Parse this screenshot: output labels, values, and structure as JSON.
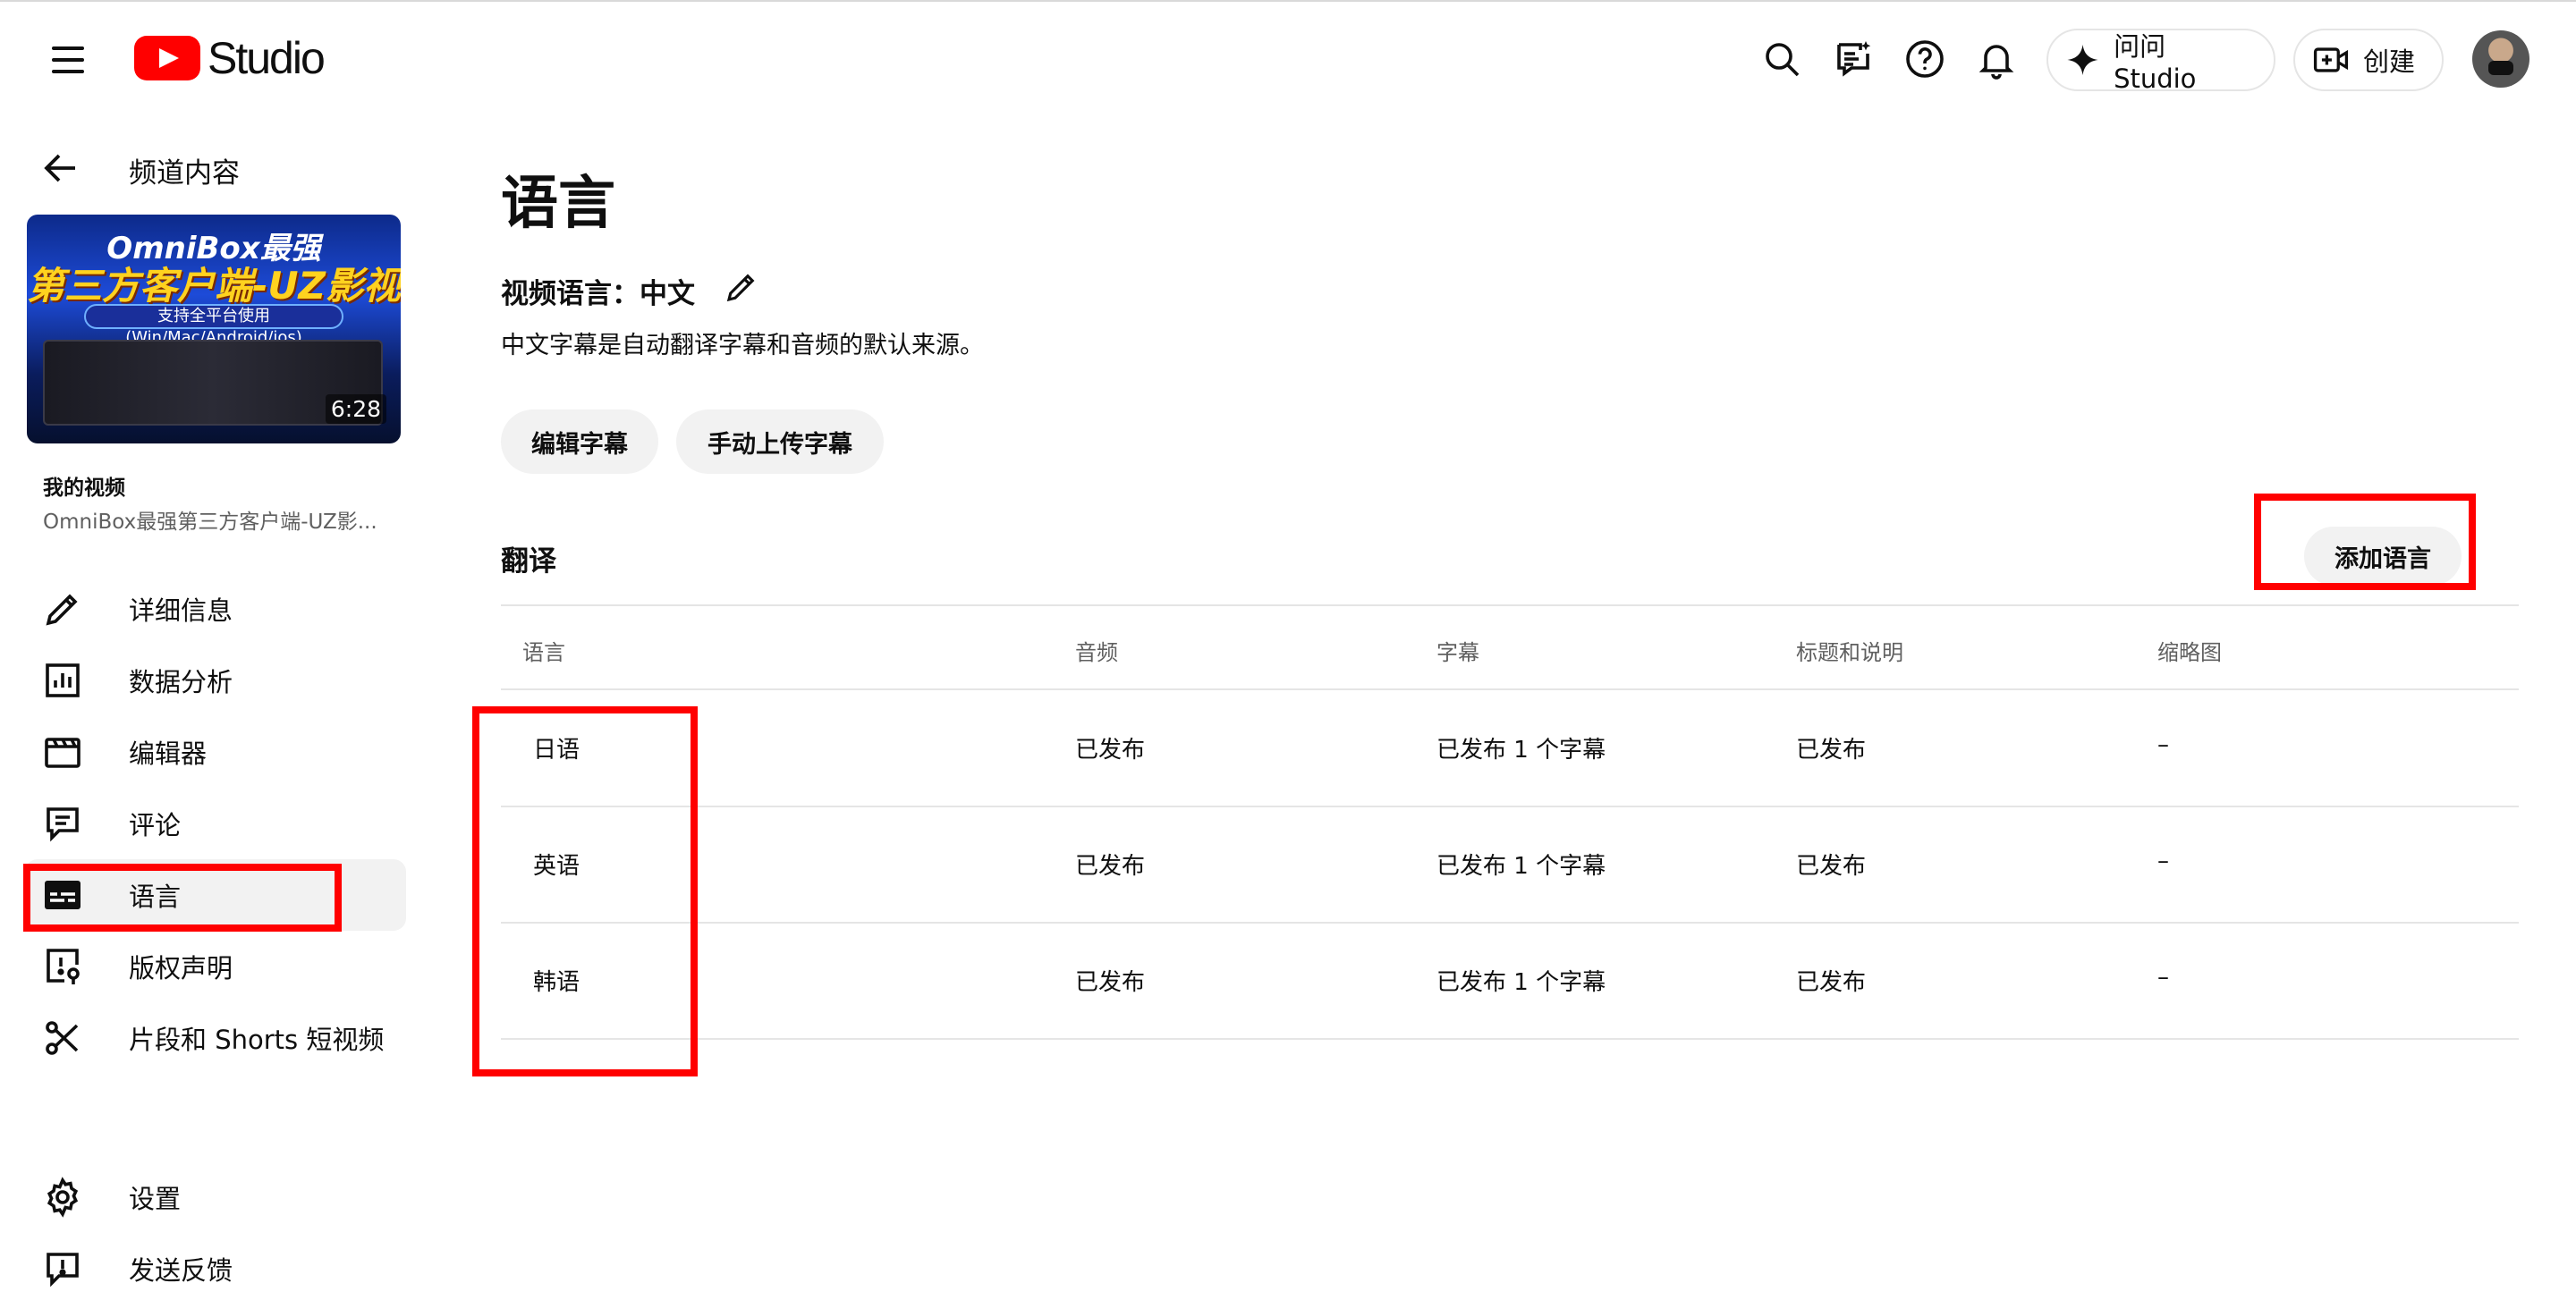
{
  "header": {
    "app_name": "Studio",
    "ask_studio_label": "问问 Studio",
    "create_label": "创建"
  },
  "sidebar": {
    "back_label": "频道内容",
    "thumbnail": {
      "line1": "OmniBox最强",
      "line2": "第三方客户端-UZ影视",
      "line3": "支持全平台使用(Win/Mac/Android/ios)",
      "duration": "6:28"
    },
    "section_title": "我的视频",
    "video_title": "OmniBox最强第三方客户端-UZ影...",
    "items": [
      {
        "label": "详细信息",
        "icon": "pencil-icon"
      },
      {
        "label": "数据分析",
        "icon": "analytics-icon"
      },
      {
        "label": "编辑器",
        "icon": "clapperboard-icon"
      },
      {
        "label": "评论",
        "icon": "comment-icon"
      },
      {
        "label": "语言",
        "icon": "subtitles-icon",
        "active": true
      },
      {
        "label": "版权声明",
        "icon": "copyright-claim-icon"
      },
      {
        "label": "片段和 Shorts 短视频",
        "icon": "scissors-icon"
      }
    ],
    "bottom_items": [
      {
        "label": "设置",
        "icon": "gear-icon"
      },
      {
        "label": "发送反馈",
        "icon": "feedback-icon"
      }
    ]
  },
  "main": {
    "title": "语言",
    "video_language": "视频语言：中文",
    "description": "中文字幕是自动翻译字幕和音频的默认来源。",
    "edit_subtitles": "编辑字幕",
    "upload_subtitles": "手动上传字幕",
    "translations_title": "翻译",
    "add_language": "添加语言",
    "columns": [
      "语言",
      "音频",
      "字幕",
      "标题和说明",
      "缩略图"
    ],
    "rows": [
      {
        "language": "日语",
        "audio": "已发布",
        "subtitles": "已发布 1 个字幕",
        "title_desc": "已发布",
        "thumbnail": "–"
      },
      {
        "language": "英语",
        "audio": "已发布",
        "subtitles": "已发布 1 个字幕",
        "title_desc": "已发布",
        "thumbnail": "–"
      },
      {
        "language": "韩语",
        "audio": "已发布",
        "subtitles": "已发布 1 个字幕",
        "title_desc": "已发布",
        "thumbnail": "–"
      }
    ]
  },
  "colors": {
    "brand_red": "#ff0000",
    "annotation_red": "#ff0000",
    "chip_bg": "#f2f2f2",
    "active_nav_bg": "#f2f2f2",
    "secondary_text": "#606060"
  }
}
